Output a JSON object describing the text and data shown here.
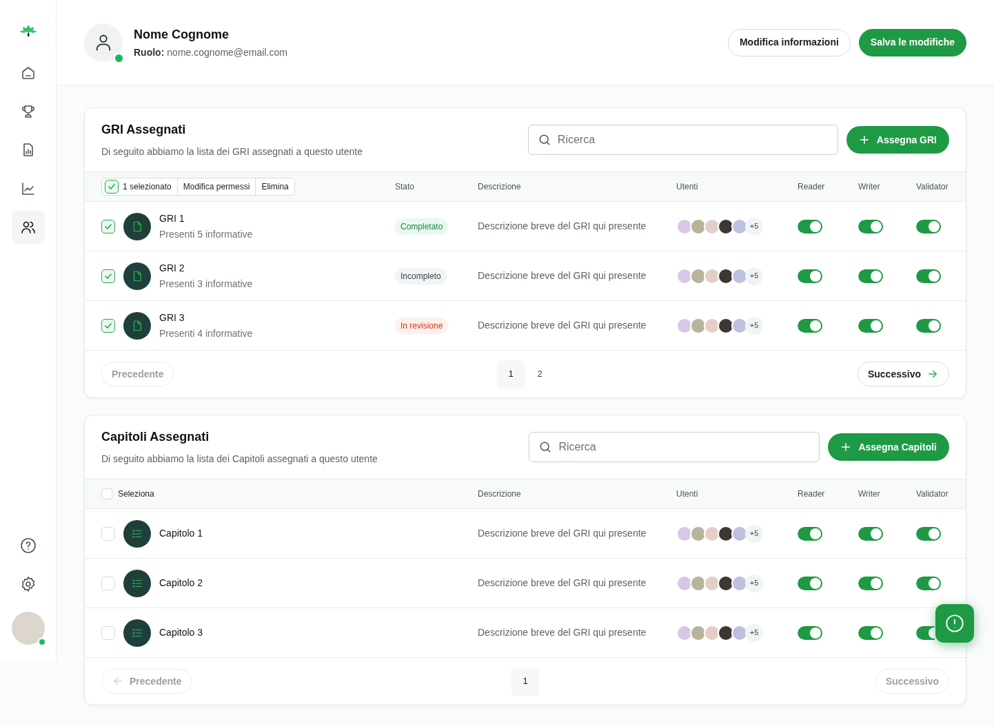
{
  "sidebar": {
    "items": [
      {
        "kind": "home",
        "selected": false
      },
      {
        "kind": "trophy",
        "selected": false
      },
      {
        "kind": "report",
        "selected": false
      },
      {
        "kind": "chart",
        "selected": false
      },
      {
        "kind": "users",
        "selected": true
      }
    ],
    "bottom_items": [
      {
        "kind": "help"
      },
      {
        "kind": "settings"
      }
    ],
    "profile_online": true
  },
  "user": {
    "name": "Nome Cognome",
    "role_label": "Ruolo:",
    "email": "nome.cognome@email.com",
    "online": true
  },
  "header_buttons": [
    {
      "label": "Modifica informazioni",
      "kind": "outline"
    },
    {
      "label": "Salva le modifiche",
      "kind": "primary"
    }
  ],
  "sections": [
    {
      "kind": "gri",
      "title": "GRI Assegnati",
      "subtitle": "Di seguito abbiamo la lista dei GRI assegnati a questo utente",
      "search": {
        "placeholder": "Ricerca"
      },
      "add_button": "Assegna GRI",
      "bulk_bar": {
        "checked": true,
        "selected_count": "1 selezionato",
        "actions": [
          "Modifica permessi",
          "Elimina"
        ]
      },
      "columns": [
        "Stato",
        "Descrizione",
        "Utenti",
        "Reader",
        "Writer",
        "Validator"
      ],
      "rows": [
        {
          "checked": true,
          "title": "GRI 1",
          "subtitle": "Presenti 5 informative",
          "status": {
            "label": "Completato",
            "kind": "done"
          },
          "description": "Descrizione breve del GRI qui presente",
          "extra_users": "+5",
          "reader": true,
          "writer": true,
          "validator": true
        },
        {
          "checked": true,
          "title": "GRI 2",
          "subtitle": "Presenti 3 informative",
          "status": {
            "label": "Incompleto",
            "kind": "incomplete"
          },
          "description": "Descrizione breve del GRI qui presente",
          "extra_users": "+5",
          "reader": true,
          "writer": true,
          "validator": true
        },
        {
          "checked": true,
          "title": "GRI 3",
          "subtitle": "Presenti 4 informative",
          "status": {
            "label": "In revisione",
            "kind": "review"
          },
          "description": "Descrizione breve del GRI qui presente",
          "extra_users": "+5",
          "reader": true,
          "writer": true,
          "validator": true
        }
      ],
      "pagination": {
        "previous": {
          "label": "Precedente",
          "disabled": true,
          "arrow": false
        },
        "pages": [
          {
            "label": "1",
            "selected": true
          },
          {
            "label": "2",
            "selected": false
          }
        ],
        "next": {
          "label": "Successivo",
          "disabled": false,
          "arrow": true
        }
      }
    },
    {
      "kind": "chapters",
      "title": "Capitoli Assegnati",
      "subtitle": "Di seguito abbiamo la lista dei Capitoli assegnati a questo utente",
      "search": {
        "placeholder": "Ricerca"
      },
      "add_button": "Assegna Capitoli",
      "select_all": {
        "checked": false,
        "label": "Seleziona"
      },
      "columns": [
        "Descrizione",
        "Utenti",
        "Reader",
        "Writer",
        "Validator"
      ],
      "rows": [
        {
          "checked": false,
          "title": "Capitolo 1",
          "description": "Descrizione breve del GRI qui presente",
          "extra_users": "+5",
          "reader": true,
          "writer": true,
          "validator": true
        },
        {
          "checked": false,
          "title": "Capitolo 2",
          "description": "Descrizione breve del GRI qui presente",
          "extra_users": "+5",
          "reader": true,
          "writer": true,
          "validator": true
        },
        {
          "checked": false,
          "title": "Capitolo 3",
          "description": "Descrizione breve del GRI qui presente",
          "extra_users": "+5",
          "reader": true,
          "writer": true,
          "validator": true
        }
      ],
      "pagination": {
        "previous": {
          "label": "Precedente",
          "disabled": true,
          "arrow": true
        },
        "pages": [
          {
            "label": "1",
            "selected": true
          }
        ],
        "next": {
          "label": "Successivo",
          "disabled": true,
          "arrow": false
        }
      }
    }
  ]
}
